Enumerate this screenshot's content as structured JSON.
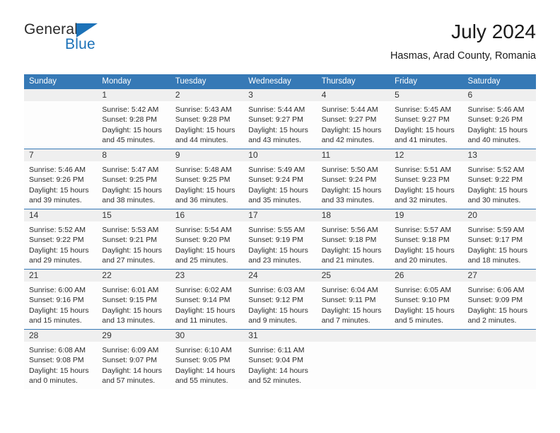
{
  "brand": {
    "name_part1": "General",
    "name_part2": "Blue",
    "accent_color": "#1c72b8"
  },
  "header": {
    "title": "July 2024",
    "subtitle": "Hasmas, Arad County, Romania"
  },
  "calendar": {
    "header_bg": "#3679b6",
    "daynum_bg": "#efefef",
    "weekdays": [
      "Sunday",
      "Monday",
      "Tuesday",
      "Wednesday",
      "Thursday",
      "Friday",
      "Saturday"
    ],
    "weeks": [
      [
        {
          "day": "",
          "sunrise": "",
          "sunset": "",
          "daylight_line1": "",
          "daylight_line2": ""
        },
        {
          "day": "1",
          "sunrise": "Sunrise: 5:42 AM",
          "sunset": "Sunset: 9:28 PM",
          "daylight_line1": "Daylight: 15 hours",
          "daylight_line2": "and 45 minutes."
        },
        {
          "day": "2",
          "sunrise": "Sunrise: 5:43 AM",
          "sunset": "Sunset: 9:28 PM",
          "daylight_line1": "Daylight: 15 hours",
          "daylight_line2": "and 44 minutes."
        },
        {
          "day": "3",
          "sunrise": "Sunrise: 5:44 AM",
          "sunset": "Sunset: 9:27 PM",
          "daylight_line1": "Daylight: 15 hours",
          "daylight_line2": "and 43 minutes."
        },
        {
          "day": "4",
          "sunrise": "Sunrise: 5:44 AM",
          "sunset": "Sunset: 9:27 PM",
          "daylight_line1": "Daylight: 15 hours",
          "daylight_line2": "and 42 minutes."
        },
        {
          "day": "5",
          "sunrise": "Sunrise: 5:45 AM",
          "sunset": "Sunset: 9:27 PM",
          "daylight_line1": "Daylight: 15 hours",
          "daylight_line2": "and 41 minutes."
        },
        {
          "day": "6",
          "sunrise": "Sunrise: 5:46 AM",
          "sunset": "Sunset: 9:26 PM",
          "daylight_line1": "Daylight: 15 hours",
          "daylight_line2": "and 40 minutes."
        }
      ],
      [
        {
          "day": "7",
          "sunrise": "Sunrise: 5:46 AM",
          "sunset": "Sunset: 9:26 PM",
          "daylight_line1": "Daylight: 15 hours",
          "daylight_line2": "and 39 minutes."
        },
        {
          "day": "8",
          "sunrise": "Sunrise: 5:47 AM",
          "sunset": "Sunset: 9:25 PM",
          "daylight_line1": "Daylight: 15 hours",
          "daylight_line2": "and 38 minutes."
        },
        {
          "day": "9",
          "sunrise": "Sunrise: 5:48 AM",
          "sunset": "Sunset: 9:25 PM",
          "daylight_line1": "Daylight: 15 hours",
          "daylight_line2": "and 36 minutes."
        },
        {
          "day": "10",
          "sunrise": "Sunrise: 5:49 AM",
          "sunset": "Sunset: 9:24 PM",
          "daylight_line1": "Daylight: 15 hours",
          "daylight_line2": "and 35 minutes."
        },
        {
          "day": "11",
          "sunrise": "Sunrise: 5:50 AM",
          "sunset": "Sunset: 9:24 PM",
          "daylight_line1": "Daylight: 15 hours",
          "daylight_line2": "and 33 minutes."
        },
        {
          "day": "12",
          "sunrise": "Sunrise: 5:51 AM",
          "sunset": "Sunset: 9:23 PM",
          "daylight_line1": "Daylight: 15 hours",
          "daylight_line2": "and 32 minutes."
        },
        {
          "day": "13",
          "sunrise": "Sunrise: 5:52 AM",
          "sunset": "Sunset: 9:22 PM",
          "daylight_line1": "Daylight: 15 hours",
          "daylight_line2": "and 30 minutes."
        }
      ],
      [
        {
          "day": "14",
          "sunrise": "Sunrise: 5:52 AM",
          "sunset": "Sunset: 9:22 PM",
          "daylight_line1": "Daylight: 15 hours",
          "daylight_line2": "and 29 minutes."
        },
        {
          "day": "15",
          "sunrise": "Sunrise: 5:53 AM",
          "sunset": "Sunset: 9:21 PM",
          "daylight_line1": "Daylight: 15 hours",
          "daylight_line2": "and 27 minutes."
        },
        {
          "day": "16",
          "sunrise": "Sunrise: 5:54 AM",
          "sunset": "Sunset: 9:20 PM",
          "daylight_line1": "Daylight: 15 hours",
          "daylight_line2": "and 25 minutes."
        },
        {
          "day": "17",
          "sunrise": "Sunrise: 5:55 AM",
          "sunset": "Sunset: 9:19 PM",
          "daylight_line1": "Daylight: 15 hours",
          "daylight_line2": "and 23 minutes."
        },
        {
          "day": "18",
          "sunrise": "Sunrise: 5:56 AM",
          "sunset": "Sunset: 9:18 PM",
          "daylight_line1": "Daylight: 15 hours",
          "daylight_line2": "and 21 minutes."
        },
        {
          "day": "19",
          "sunrise": "Sunrise: 5:57 AM",
          "sunset": "Sunset: 9:18 PM",
          "daylight_line1": "Daylight: 15 hours",
          "daylight_line2": "and 20 minutes."
        },
        {
          "day": "20",
          "sunrise": "Sunrise: 5:59 AM",
          "sunset": "Sunset: 9:17 PM",
          "daylight_line1": "Daylight: 15 hours",
          "daylight_line2": "and 18 minutes."
        }
      ],
      [
        {
          "day": "21",
          "sunrise": "Sunrise: 6:00 AM",
          "sunset": "Sunset: 9:16 PM",
          "daylight_line1": "Daylight: 15 hours",
          "daylight_line2": "and 15 minutes."
        },
        {
          "day": "22",
          "sunrise": "Sunrise: 6:01 AM",
          "sunset": "Sunset: 9:15 PM",
          "daylight_line1": "Daylight: 15 hours",
          "daylight_line2": "and 13 minutes."
        },
        {
          "day": "23",
          "sunrise": "Sunrise: 6:02 AM",
          "sunset": "Sunset: 9:14 PM",
          "daylight_line1": "Daylight: 15 hours",
          "daylight_line2": "and 11 minutes."
        },
        {
          "day": "24",
          "sunrise": "Sunrise: 6:03 AM",
          "sunset": "Sunset: 9:12 PM",
          "daylight_line1": "Daylight: 15 hours",
          "daylight_line2": "and 9 minutes."
        },
        {
          "day": "25",
          "sunrise": "Sunrise: 6:04 AM",
          "sunset": "Sunset: 9:11 PM",
          "daylight_line1": "Daylight: 15 hours",
          "daylight_line2": "and 7 minutes."
        },
        {
          "day": "26",
          "sunrise": "Sunrise: 6:05 AM",
          "sunset": "Sunset: 9:10 PM",
          "daylight_line1": "Daylight: 15 hours",
          "daylight_line2": "and 5 minutes."
        },
        {
          "day": "27",
          "sunrise": "Sunrise: 6:06 AM",
          "sunset": "Sunset: 9:09 PM",
          "daylight_line1": "Daylight: 15 hours",
          "daylight_line2": "and 2 minutes."
        }
      ],
      [
        {
          "day": "28",
          "sunrise": "Sunrise: 6:08 AM",
          "sunset": "Sunset: 9:08 PM",
          "daylight_line1": "Daylight: 15 hours",
          "daylight_line2": "and 0 minutes."
        },
        {
          "day": "29",
          "sunrise": "Sunrise: 6:09 AM",
          "sunset": "Sunset: 9:07 PM",
          "daylight_line1": "Daylight: 14 hours",
          "daylight_line2": "and 57 minutes."
        },
        {
          "day": "30",
          "sunrise": "Sunrise: 6:10 AM",
          "sunset": "Sunset: 9:05 PM",
          "daylight_line1": "Daylight: 14 hours",
          "daylight_line2": "and 55 minutes."
        },
        {
          "day": "31",
          "sunrise": "Sunrise: 6:11 AM",
          "sunset": "Sunset: 9:04 PM",
          "daylight_line1": "Daylight: 14 hours",
          "daylight_line2": "and 52 minutes."
        },
        {
          "day": "",
          "sunrise": "",
          "sunset": "",
          "daylight_line1": "",
          "daylight_line2": ""
        },
        {
          "day": "",
          "sunrise": "",
          "sunset": "",
          "daylight_line1": "",
          "daylight_line2": ""
        },
        {
          "day": "",
          "sunrise": "",
          "sunset": "",
          "daylight_line1": "",
          "daylight_line2": ""
        }
      ]
    ]
  }
}
